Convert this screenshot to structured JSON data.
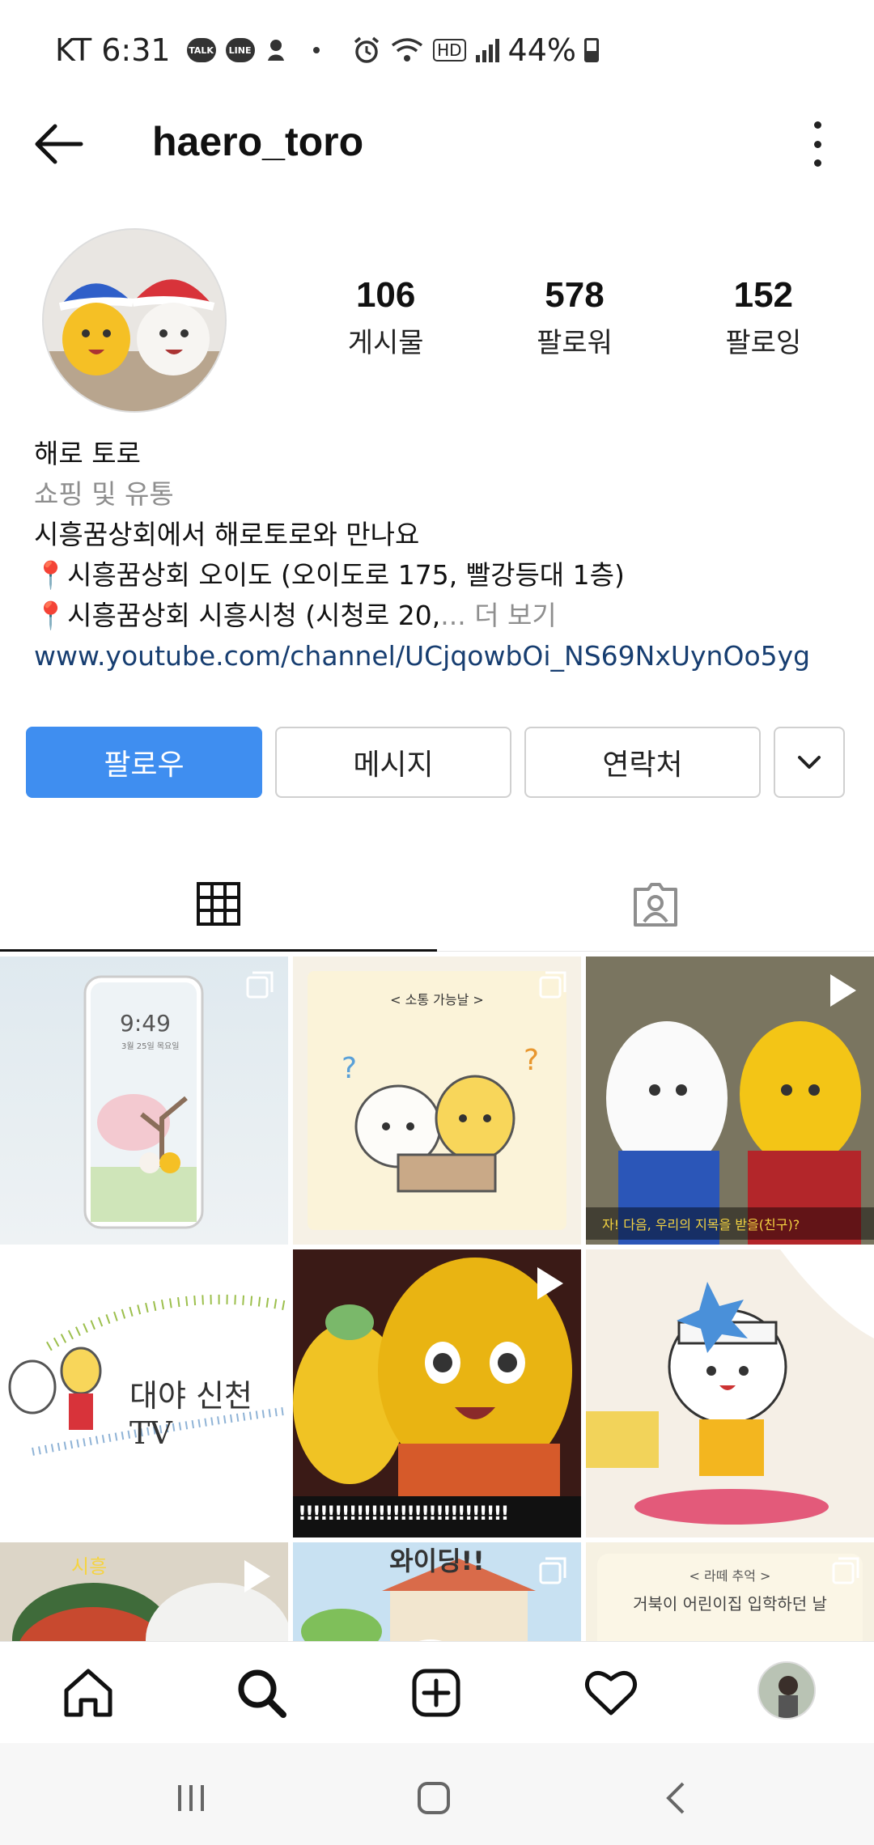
{
  "status_bar": {
    "carrier_time": "KT 6:31",
    "notif_badges": [
      "TALK",
      "LINE"
    ],
    "battery": "44%",
    "network": "HD"
  },
  "header": {
    "username": "haero_toro"
  },
  "profile": {
    "stats": [
      {
        "value": "106",
        "label": "게시물"
      },
      {
        "value": "578",
        "label": "팔로워"
      },
      {
        "value": "152",
        "label": "팔로잉"
      }
    ],
    "name": "해로 토로",
    "category": "쇼핑 및 유통",
    "bio_line1": "시흥꿈상회에서 해로토로와 만나요",
    "bio_line2": "📍시흥꿈상회 오이도 (오이도로 175, 빨강등대 1층)",
    "bio_line3": "📍시흥꿈상회 시흥시청 (시청로 20,",
    "bio_more": "... 더 보기",
    "link": "www.youtube.com/channel/UCjqowbOi_NS69NxUynOo5yg"
  },
  "actions": {
    "follow": "팔로우",
    "message": "메시지",
    "contact": "연락처"
  },
  "posts": {
    "phone_time": "9:49",
    "phone_date": "3월 25일 목요일",
    "tile2_caption": "< 소통 가능날 >",
    "tile3_caption": "자! 다음, 우리의 지목을 받을(친구)?",
    "tile4_caption": "대야 신천 TV",
    "tile5_caption": "!!!!!!!!!!!!!!!!!!!!!!!!!!!!!",
    "tile8_caption": "와이딩!!",
    "tile9_caption_a": "< 라떼 추억 >",
    "tile9_caption_b": "거북이 어린이집 입학하던 날",
    "tile7_label": "시흥"
  },
  "colors": {
    "accent": "#3f8ef0",
    "link": "#173e71",
    "muted": "#8e8e8e"
  }
}
